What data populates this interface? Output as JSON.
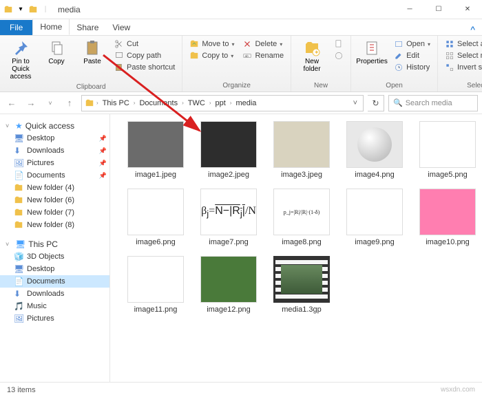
{
  "window": {
    "title": "media"
  },
  "tabs": {
    "file": "File",
    "home": "Home",
    "share": "Share",
    "view": "View"
  },
  "ribbon": {
    "clipboard": {
      "label": "Clipboard",
      "pin": "Pin to Quick access",
      "copy": "Copy",
      "paste": "Paste",
      "cut": "Cut",
      "copy_path": "Copy path",
      "paste_shortcut": "Paste shortcut"
    },
    "organize": {
      "label": "Organize",
      "move_to": "Move to",
      "copy_to": "Copy to",
      "delete": "Delete",
      "rename": "Rename"
    },
    "new": {
      "label": "New",
      "new_folder": "New folder"
    },
    "open": {
      "label": "Open",
      "properties": "Properties",
      "open": "Open",
      "edit": "Edit",
      "history": "History"
    },
    "select": {
      "label": "Select",
      "select_all": "Select all",
      "select_none": "Select none",
      "invert": "Invert selection"
    }
  },
  "breadcrumb": [
    "This PC",
    "Documents",
    "TWC",
    "ppt",
    "media"
  ],
  "search": {
    "placeholder": "Search media"
  },
  "sidebar": {
    "quick_access": {
      "label": "Quick access",
      "items": [
        "Desktop",
        "Downloads",
        "Pictures",
        "Documents",
        "New folder (4)",
        "New folder (6)",
        "New folder (7)",
        "New folder (8)"
      ]
    },
    "this_pc": {
      "label": "This PC",
      "items": [
        "3D Objects",
        "Desktop",
        "Documents",
        "Downloads",
        "Music",
        "Pictures"
      ]
    }
  },
  "files": [
    "image1.jpeg",
    "image2.jpeg",
    "image3.jpeg",
    "image4.png",
    "image5.png",
    "image6.png",
    "image7.png",
    "image8.png",
    "image9.png",
    "image10.png",
    "image11.png",
    "image12.png",
    "media1.3gp"
  ],
  "thumb_colors": [
    "#6b6b6b",
    "#2d2d2d",
    "#d9d3bf",
    "#e8e8e8",
    "#ffffff",
    "#ffffff",
    "#ffffff",
    "#ffffff",
    "#ffffff",
    "#ff7eb0",
    "#ffffff",
    "#4a7a3a",
    "#5a7a5a"
  ],
  "status": {
    "count": "13 items"
  },
  "watermark": "wsxdn.com"
}
